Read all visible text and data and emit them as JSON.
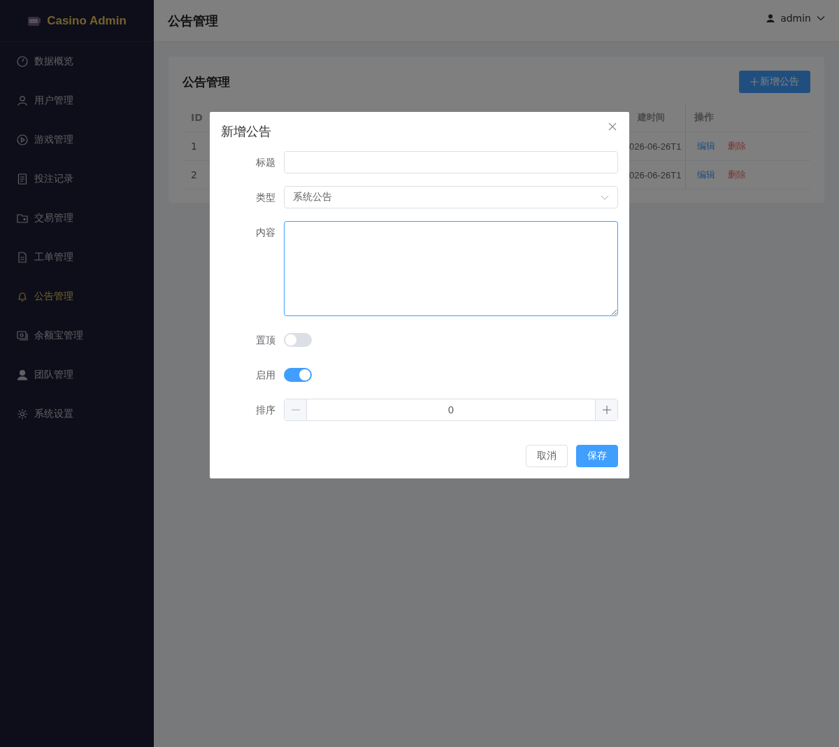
{
  "app": {
    "brand": "Casino Admin"
  },
  "sidebar": {
    "items": [
      {
        "label": "数据概览",
        "selected": false
      },
      {
        "label": "用户管理",
        "selected": false
      },
      {
        "label": "游戏管理",
        "selected": false
      },
      {
        "label": "投注记录",
        "selected": false
      },
      {
        "label": "交易管理",
        "selected": false
      },
      {
        "label": "工单管理",
        "selected": false
      },
      {
        "label": "公告管理",
        "selected": true
      },
      {
        "label": "余额宝管理",
        "selected": false
      },
      {
        "label": "团队管理",
        "selected": false
      },
      {
        "label": "系统设置",
        "selected": false
      }
    ]
  },
  "header": {
    "title": "公告管理",
    "user": "admin"
  },
  "card": {
    "title": "公告管理",
    "add_button": "新增公告"
  },
  "table": {
    "columns": [
      "ID",
      "建时间",
      "操作"
    ],
    "rows": [
      {
        "id": "1",
        "created": "026-06-26T1",
        "actions": [
          "编辑",
          "删除"
        ]
      },
      {
        "id": "2",
        "created": "026-06-26T1",
        "actions": [
          "编辑",
          "删除"
        ]
      }
    ]
  },
  "dialog": {
    "title": "新增公告",
    "fields": [
      {
        "kind": "input",
        "label": "标题"
      },
      {
        "kind": "select",
        "label": "类型",
        "value": "系统公告"
      },
      {
        "kind": "textarea",
        "label": "内容",
        "focused": true
      },
      {
        "kind": "switch",
        "label": "置顶",
        "on": false
      },
      {
        "kind": "switch",
        "label": "启用",
        "on": true
      },
      {
        "kind": "number",
        "label": "排序",
        "value": "0"
      }
    ],
    "buttons": [
      {
        "label": "取消",
        "kind": "default"
      },
      {
        "label": "保存",
        "kind": "primary"
      }
    ]
  }
}
